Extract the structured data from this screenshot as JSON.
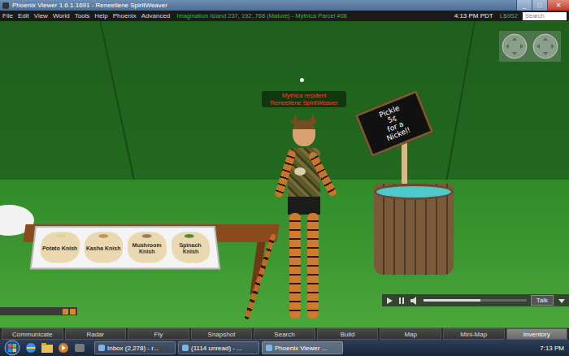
{
  "window": {
    "title": "Phoenix Viewer 1.6.1.1691 - Reneellene SpiritWeaver",
    "controls": [
      {
        "glyph": "_",
        "kind": "minimize"
      },
      {
        "glyph": "□",
        "kind": "maximize"
      },
      {
        "glyph": "✕",
        "kind": "close"
      }
    ]
  },
  "menu": [
    "File",
    "Edit",
    "View",
    "World",
    "Tools",
    "Help",
    "Phoenix",
    "Advanced"
  ],
  "status": {
    "location": "Imagination Island 237, 192, 768 (Mature) - Mythica Parcel #06",
    "time": "4:13 PM PDT",
    "balance": "L$952",
    "search_placeholder": "Search"
  },
  "scene": {
    "name_tag": [
      "Mythica resident",
      "Reneellene SpiritWeaver"
    ],
    "knishes": [
      {
        "label": "Potato Knish",
        "color": "#e3cf96"
      },
      {
        "label": "Kasha Knish",
        "color": "#b8955e"
      },
      {
        "label": "Mushroom Knish",
        "color": "#9c7a55"
      },
      {
        "label": "Spinach Knish",
        "color": "#4f8a33"
      }
    ],
    "sign": [
      "Pickle",
      "5¢",
      "for a",
      "Nickel!"
    ]
  },
  "media": {
    "talk": "Talk",
    "volume_level": 0.55
  },
  "toolbar": [
    {
      "label": "Communicate",
      "selected": false
    },
    {
      "label": "Radar",
      "selected": false
    },
    {
      "label": "Fly",
      "selected": false
    },
    {
      "label": "Snapshot",
      "selected": false
    },
    {
      "label": "Search",
      "selected": false
    },
    {
      "label": "Build",
      "selected": false
    },
    {
      "label": "Map",
      "selected": false
    },
    {
      "label": "Mini-Map",
      "selected": false
    },
    {
      "label": "Inventory",
      "selected": true
    }
  ],
  "taskbar": {
    "tasks": [
      {
        "label": "Inbox (2,278) - r...",
        "selected": false
      },
      {
        "label": "(1114 unread) - ...",
        "selected": false
      },
      {
        "label": "Phoenix Viewer ...",
        "selected": true
      }
    ],
    "clock": "7:13 PM"
  }
}
